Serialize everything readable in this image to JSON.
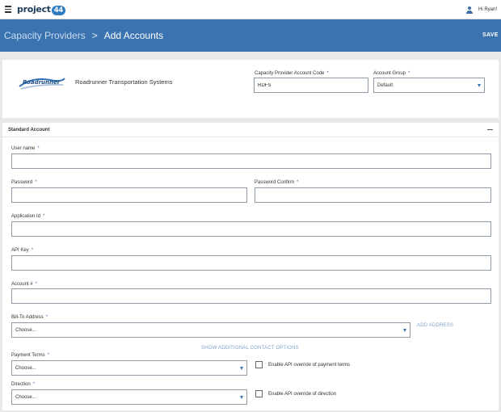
{
  "header": {
    "brand": "project",
    "brand_num": "44",
    "greeting": "Hi Ryan!"
  },
  "title": {
    "parent": "Capacity Providers",
    "separator": ">",
    "current": "Add Accounts",
    "save_label": "SAVE"
  },
  "provider": {
    "name": "Roadrunner Transportation Systems",
    "logo_text": "Roadrunner",
    "account_code_label": "Capacity Provider Account Code",
    "account_code_value": "RDFS",
    "account_group_label": "Account Group",
    "account_group_value": "Default"
  },
  "section": {
    "title": "Standard Account"
  },
  "fields": {
    "username_label": "User name",
    "password_label": "Password",
    "password_confirm_label": "Password Confirm",
    "application_id_label": "Application Id",
    "api_key_label": "API Key",
    "account_num_label": "Account #",
    "bill_to_label": "Bill-To Address",
    "bill_to_value": "Choose...",
    "add_address": "ADD ADDRESS",
    "show_more": "SHOW ADDITIONAL CONTACT OPTIONS",
    "payment_terms_label": "Payment Terms",
    "payment_terms_value": "Choose...",
    "override_payment_label": "Enable API override of payment terms",
    "direction_label": "Direction",
    "direction_value": "Choose...",
    "override_direction_label": "Enable API override of direction"
  },
  "required_marker": "*",
  "colors": {
    "primary": "#3a73b0",
    "link": "#7ea4cc"
  },
  "icons": [
    "menu-icon",
    "user-icon",
    "chevron-down-icon",
    "minus-icon"
  ]
}
